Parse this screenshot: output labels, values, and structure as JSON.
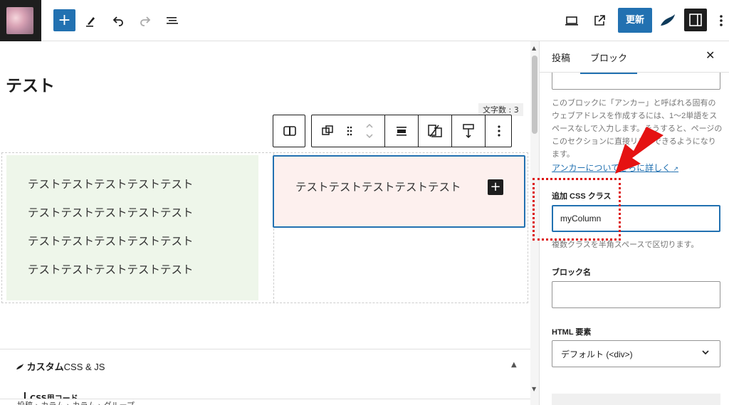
{
  "toolbar": {
    "update_label": "更新"
  },
  "editor": {
    "page_title": "テスト",
    "word_count": "文字数 : 3",
    "column1_lines": [
      "テストテストテストテストテスト",
      "テストテストテストテストテスト",
      "テストテストテストテストテスト",
      "テストテストテストテストテスト"
    ],
    "column2_text": "テストテストテストテストテスト"
  },
  "meta_panel": {
    "title_bold": "カスタム",
    "title_rest": "CSS & JS",
    "code_label": "CSS用コード"
  },
  "breadcrumb": "投稿 › カラム › カラム › グループ",
  "sidebar": {
    "tab_post": "投稿",
    "tab_block": "ブロック",
    "anchor_help": "このブロックに「アンカー」と呼ばれる固有のウェブアドレスを作成するには、1〜2単語をスペースなしで入力します。そうすると、ページのこのセクションに直接リンクできるようになります。",
    "anchor_link": "アンカーについてさらに詳しく",
    "css_class_label": "追加 CSS クラス",
    "css_class_value": "myColumn",
    "css_class_help": "複数クラスを半角スペースで区切ります。",
    "block_name_label": "ブロック名",
    "html_element_label": "HTML 要素",
    "html_element_value": "デフォルト (<div>)"
  },
  "colors": {
    "accent": "#2271b1",
    "annotation": "#dd1111"
  }
}
